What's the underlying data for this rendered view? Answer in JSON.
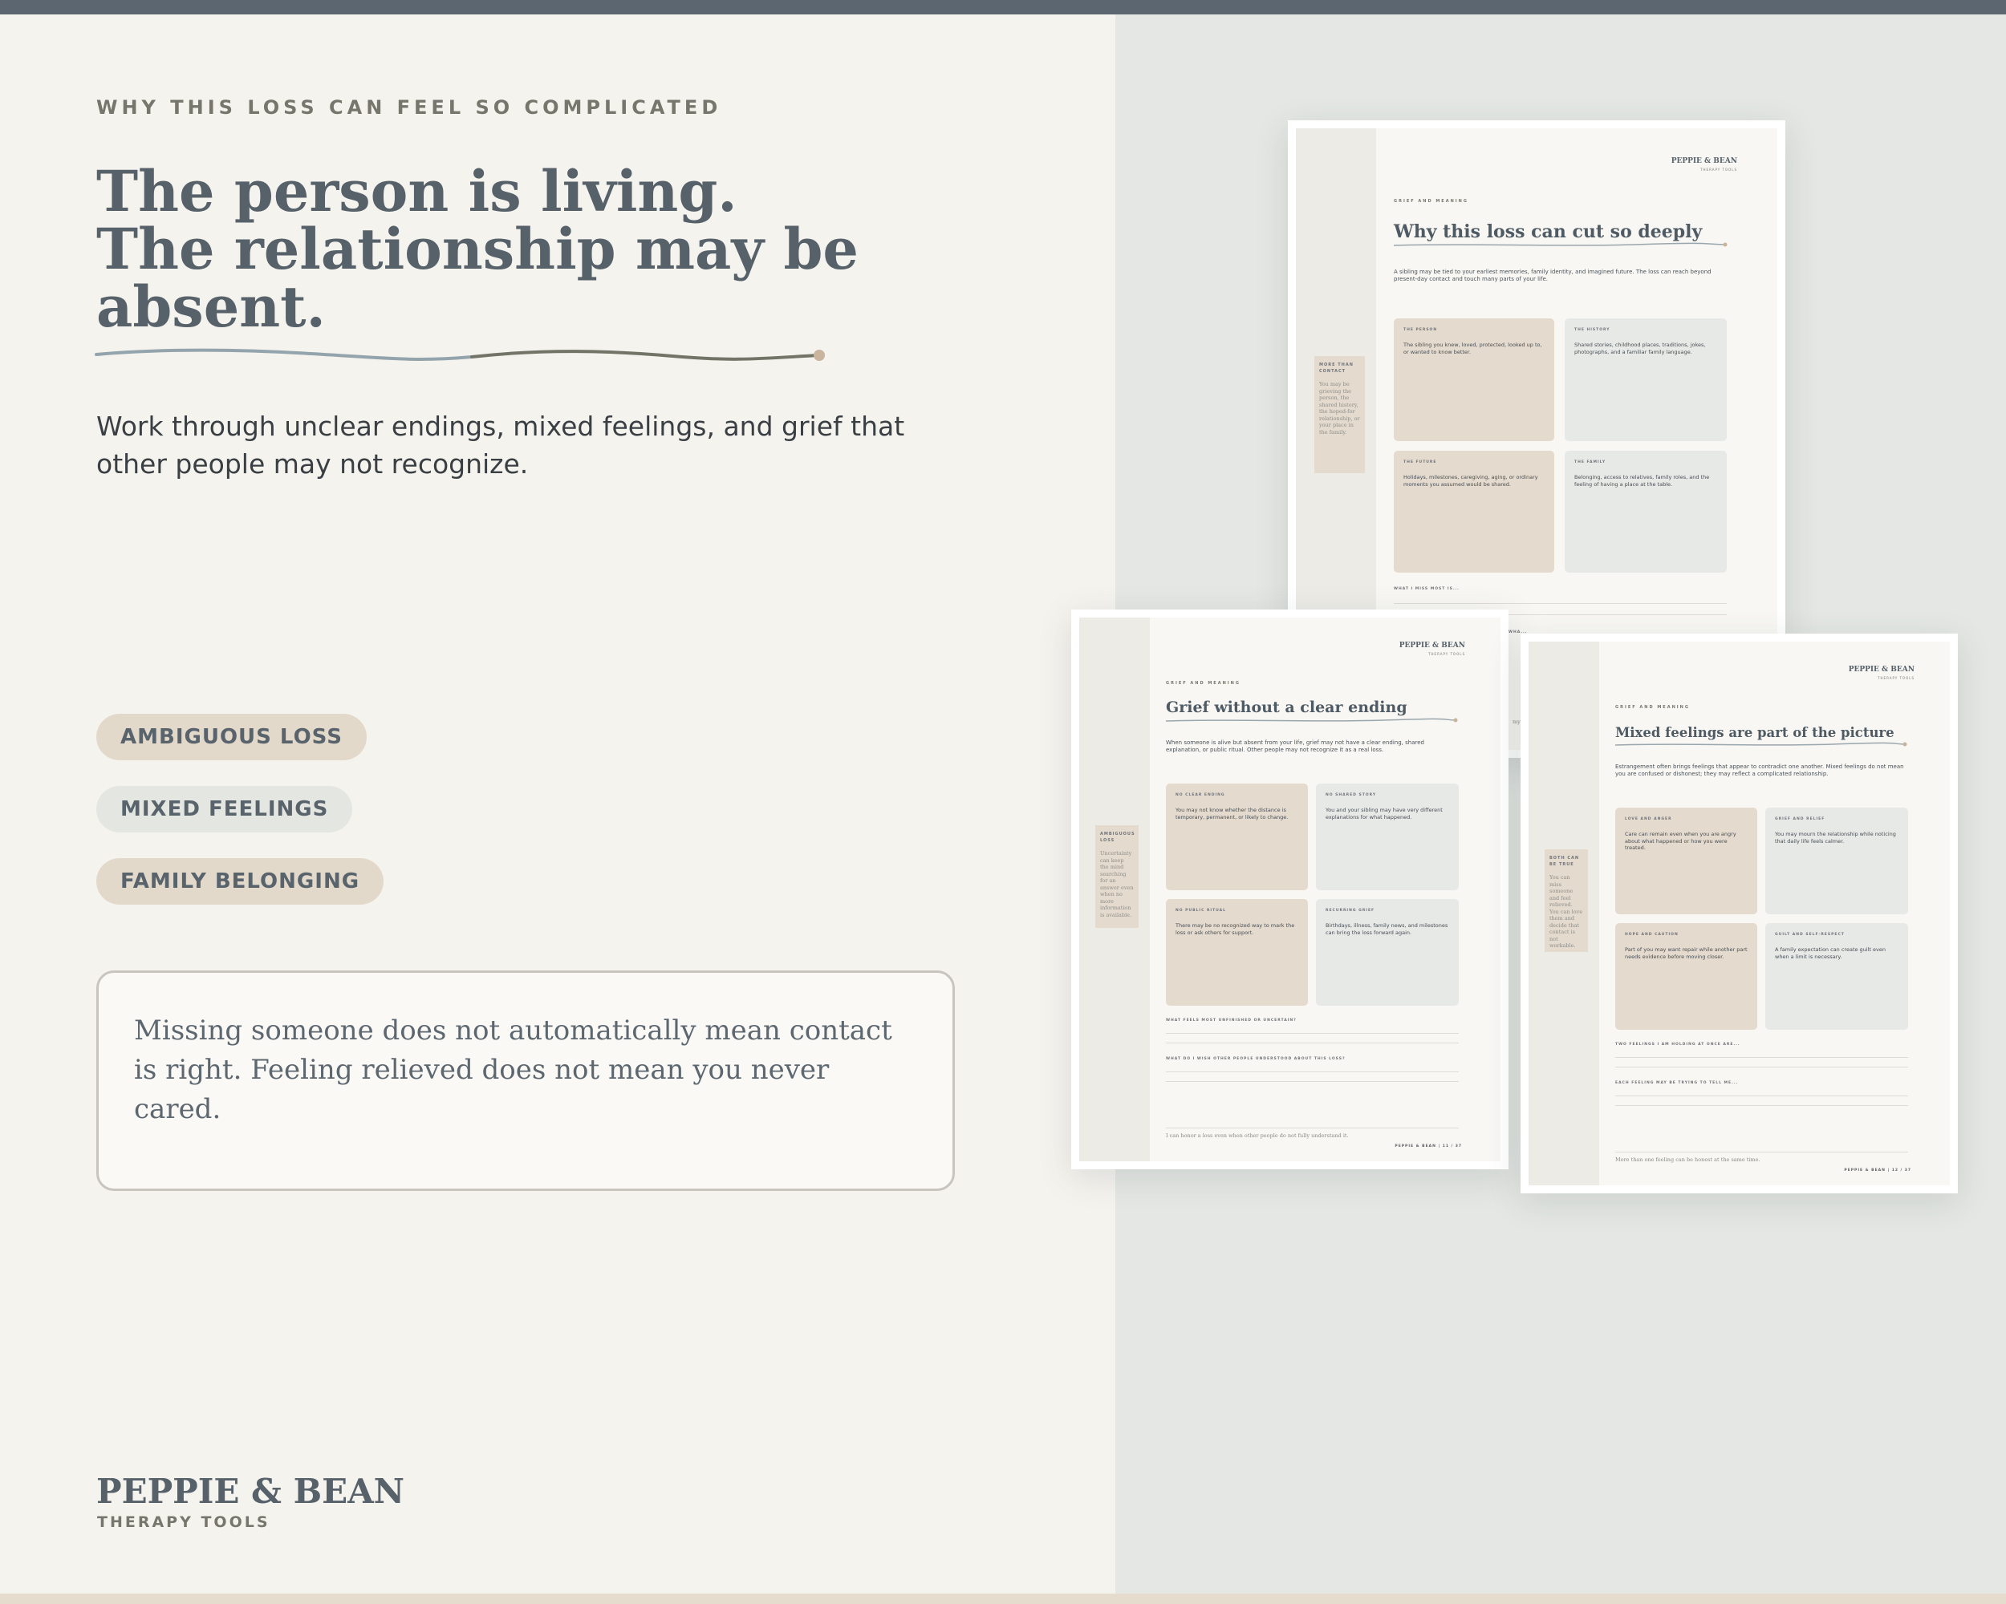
{
  "eyebrow": "WHY THIS LOSS CAN FEEL SO COMPLICATED",
  "headline": [
    "The person is living.",
    "The relationship may be",
    "absent."
  ],
  "subtext": "Work through unclear endings, mixed feelings, and grief that other people may not recognize.",
  "tags": [
    "AMBIGUOUS LOSS",
    "MIXED FEELINGS",
    "FAMILY BELONGING"
  ],
  "quote": "Missing someone does not automatically mean contact is right. Feeling relieved does not mean you never cared.",
  "brand": {
    "name": "PEPPIE & BEAN",
    "tagline": "THERAPY TOOLS"
  },
  "colors": {
    "accent": "#56616a",
    "tan": "#e3d9cb",
    "grey": "#e4e6e2",
    "panel": "#e4e7e3",
    "topbar": "#5b6670"
  },
  "worksheets": [
    {
      "logo": "PEPPIE & BEAN",
      "logo_sub": "THERAPY TOOLS",
      "eyebrow": "GRIEF AND MEANING",
      "title": "Why this loss can cut so deeply",
      "intro": "A sibling may be tied to your earliest memories, family identity, and imagined future. The loss can reach beyond present-day contact and touch many parts of your life.",
      "note_label": "MORE THAN CONTACT",
      "note_text": "You may be grieving the person, the shared history, the hoped-for relationship, or your place in the family.",
      "cards": [
        {
          "label": "THE PERSON",
          "text": "The sibling you knew, loved, protected, looked up to, or wanted to know better."
        },
        {
          "label": "THE HISTORY",
          "text": "Shared stories, childhood places, traditions, jokes, photographs, and a familiar family language."
        },
        {
          "label": "THE FUTURE",
          "text": "Holidays, milestones, caregiving, aging, or ordinary moments you assumed would be shared."
        },
        {
          "label": "THE FAMILY",
          "text": "Belonging, access to relatives, family roles, and the feeling of having a place at the table."
        }
      ],
      "questions": [
        "WHAT I MISS MOST IS...",
        "WHA..."
      ],
      "footer": "my"
    },
    {
      "logo": "PEPPIE & BEAN",
      "logo_sub": "THERAPY TOOLS",
      "eyebrow": "GRIEF AND MEANING",
      "title": "Grief without a clear ending",
      "intro": "When someone is alive but absent from your life, grief may not have a clear ending, shared explanation, or public ritual. Other people may not recognize it as a real loss.",
      "note_label": "AMBIGUOUS LOSS",
      "note_text": "Uncertainty can keep the mind searching for an answer even when no more information is available.",
      "cards": [
        {
          "label": "NO CLEAR ENDING",
          "text": "You may not know whether the distance is temporary, permanent, or likely to change."
        },
        {
          "label": "NO SHARED STORY",
          "text": "You and your sibling may have very different explanations for what happened."
        },
        {
          "label": "NO PUBLIC RITUAL",
          "text": "There may be no recognized way to mark the loss or ask others for support."
        },
        {
          "label": "RECURRING GRIEF",
          "text": "Birthdays, illness, family news, and milestones can bring the loss forward again."
        }
      ],
      "questions": [
        "WHAT FEELS MOST UNFINISHED OR UNCERTAIN?",
        "WHAT DO I WISH OTHER PEOPLE UNDERSTOOD ABOUT THIS LOSS?"
      ],
      "footer": "I can honor a loss even when other people do not fully understand it.",
      "page": "PEPPIE & BEAN | 11 / 37"
    },
    {
      "logo": "PEPPIE & BEAN",
      "logo_sub": "THERAPY TOOLS",
      "eyebrow": "GRIEF AND MEANING",
      "title": "Mixed feelings are part of the picture",
      "intro": "Estrangement often brings feelings that appear to contradict one another. Mixed feelings do not mean you are confused or dishonest; they may reflect a complicated relationship.",
      "note_label": "BOTH CAN BE TRUE",
      "note_text": "You can miss someone and feel relieved. You can love them and decide that contact is not workable.",
      "cards": [
        {
          "label": "LOVE AND ANGER",
          "text": "Care can remain even when you are angry about what happened or how you were treated."
        },
        {
          "label": "GRIEF AND RELIEF",
          "text": "You may mourn the relationship while noticing that daily life feels calmer."
        },
        {
          "label": "HOPE AND CAUTION",
          "text": "Part of you may want repair while another part needs evidence before moving closer."
        },
        {
          "label": "GUILT AND SELF-RESPECT",
          "text": "A family expectation can create guilt even when a limit is necessary."
        }
      ],
      "questions": [
        "TWO FEELINGS I AM HOLDING AT ONCE ARE...",
        "EACH FEELING MAY BE TRYING TO TELL ME..."
      ],
      "footer": "More than one feeling can be honest at the same time.",
      "page": "PEPPIE & BEAN | 12 / 37"
    }
  ]
}
